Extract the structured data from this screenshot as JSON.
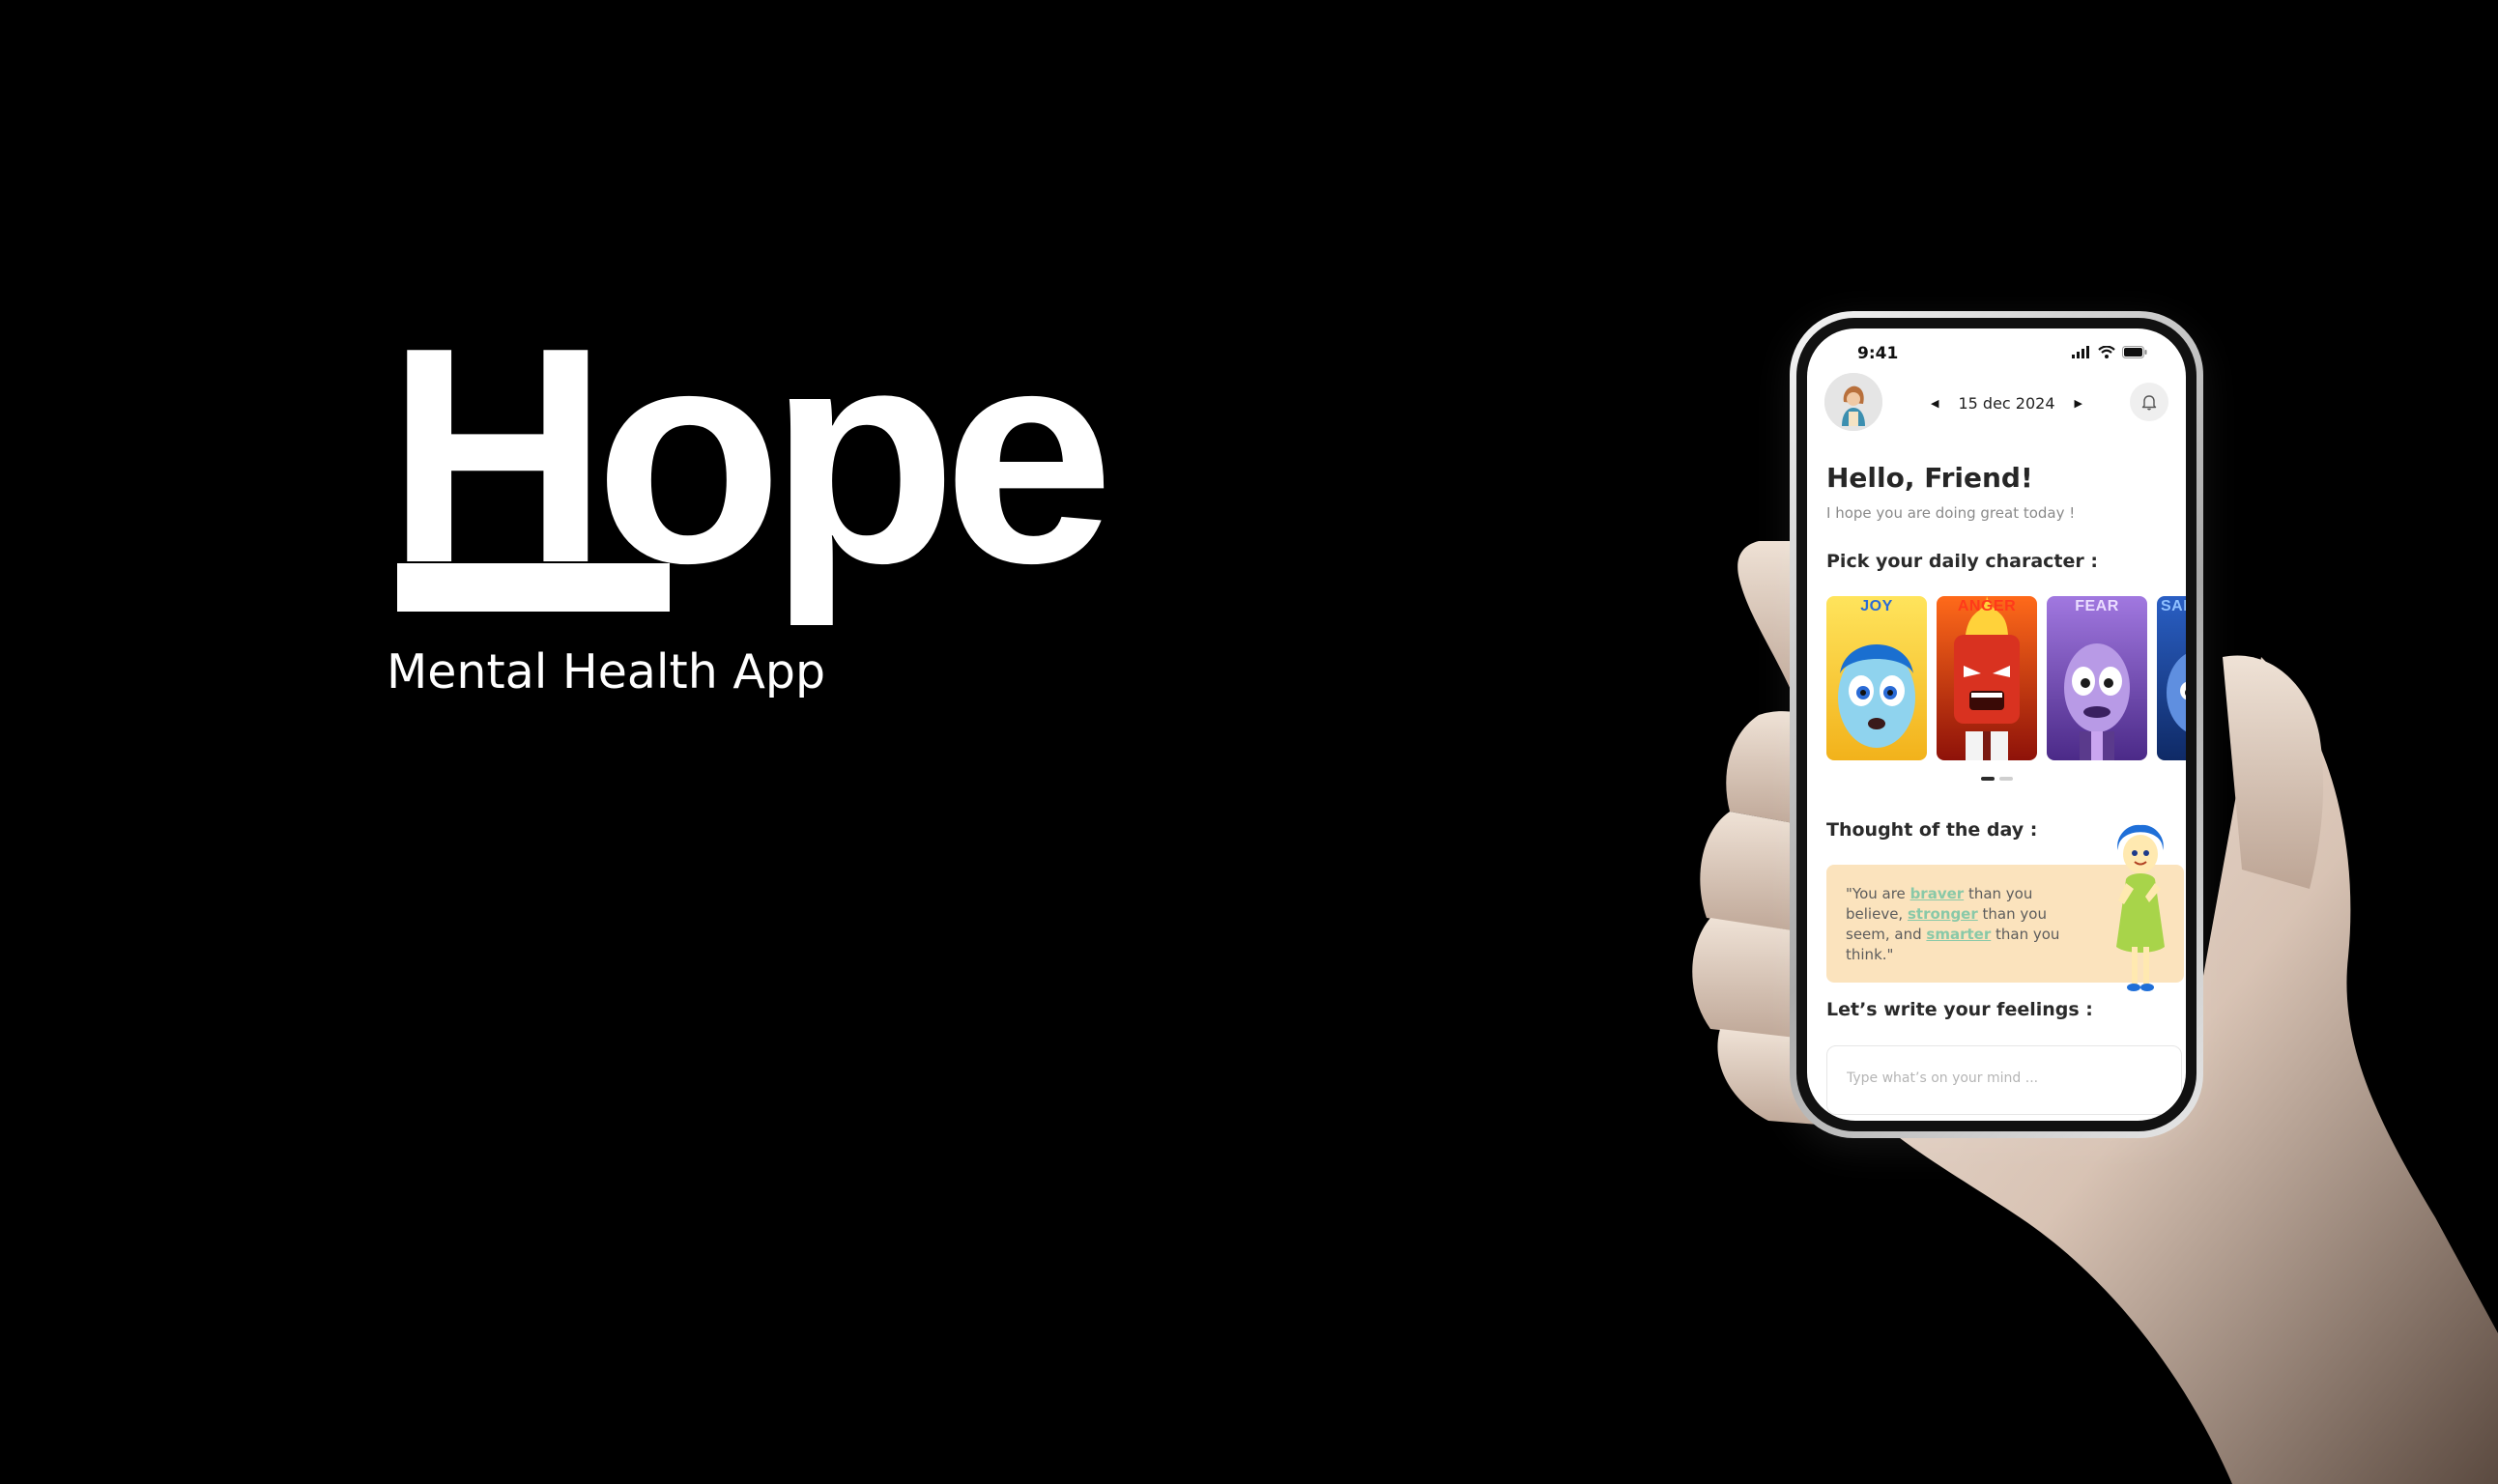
{
  "brand": {
    "logo_text": "Hope",
    "tagline": "Mental Health App"
  },
  "phone": {
    "status_bar": {
      "time": "9:41"
    },
    "header": {
      "date": "15 dec 2024",
      "prev_icon": "chevron-left-icon",
      "next_icon": "chevron-right-icon",
      "notification_icon": "bell-icon"
    },
    "greeting": {
      "title": "Hello, Friend!",
      "subtitle": "I hope you are doing great today !"
    },
    "characters": {
      "title": "Pick your daily character :",
      "items": [
        {
          "name": "JOY",
          "color": "#f5c526"
        },
        {
          "name": "ANGER",
          "color": "#c92a1b"
        },
        {
          "name": "FEAR",
          "color": "#7d4fb8"
        },
        {
          "name": "SAD",
          "color": "#1f4fa8"
        }
      ],
      "page_count": 2,
      "active_page": 0
    },
    "thought": {
      "title": "Thought of the day :",
      "quote_parts": {
        "p1": "\"You are ",
        "h1": "braver",
        "p2": " than you believe, ",
        "h2": "stronger",
        "p3": " than you seem, and ",
        "h3": "smarter",
        "p4": " than you think.\""
      },
      "card_color": "#fbe3bd",
      "highlight_color": "#89c9a8"
    },
    "feelings": {
      "title": "Let’s write your feelings :",
      "placeholder": "Type what’s on your mind ...",
      "value": ""
    }
  }
}
